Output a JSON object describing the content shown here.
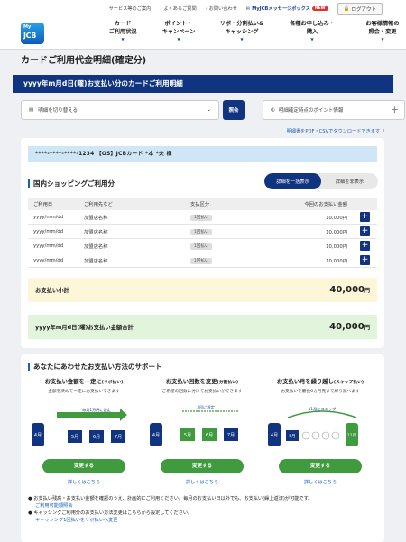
{
  "topbar": {
    "links": [
      "サービス等のご案内",
      "よくあるご質問",
      "お問い合わせ"
    ],
    "message_box": "MyJCBメッセージボックス",
    "new_badge": "NEW",
    "logout": "ログアウト"
  },
  "logo": {
    "my": "My",
    "jcb": "JCB"
  },
  "nav": [
    {
      "line1": "カード",
      "line2": "ご利用状況"
    },
    {
      "line1": "ポイント・",
      "line2": "キャンペーン"
    },
    {
      "line1": "リボ・分割払い&",
      "line2": "キャッシング"
    },
    {
      "line1": "各種お申し込み・",
      "line2": "購入"
    },
    {
      "line1": "お客様情報の",
      "line2": "照会・変更"
    }
  ],
  "page_title": "カードご利用代金明細(確定分)",
  "statement_bar": "yyyy年m月d日(曜)お支払い分のカードご利用明細",
  "controls": {
    "switch_label": "明細を切り替える",
    "apply_label": "照会",
    "point_label": "明細確定時点のポイント情報"
  },
  "download_link": "明細書をPDF・CSVでダウンロードできます",
  "card_band": "****-****-****-1234 【OS】JCBカード *本 *夫 様",
  "domestic": {
    "title": "国内ショッピングご利用分",
    "toggle_show": "詳細を一括表示",
    "toggle_hide": "詳細を非表示",
    "headers": [
      "ご利用日",
      "ご利用先など",
      "支払区分",
      "今回のお支払い金額"
    ],
    "rows": [
      {
        "date": "yyyy/mm/dd",
        "shop": "加盟店名称",
        "type": "1回払い",
        "amount": "10,000円"
      },
      {
        "date": "yyyy/mm/dd",
        "shop": "加盟店名称",
        "type": "1回払い",
        "amount": "10,000円"
      },
      {
        "date": "yyyy/mm/dd",
        "shop": "加盟店名称",
        "type": "1回払い",
        "amount": "10,000円"
      },
      {
        "date": "yyyy/mm/dd",
        "shop": "加盟店名称",
        "type": "1回払い",
        "amount": "10,000円"
      }
    ],
    "subtotal_label": "お支払い小計",
    "subtotal_amount": "40,000",
    "yen": "円"
  },
  "grand_total": {
    "label": "yyyy年m月d日(曜)お支払い金額合計",
    "amount": "40,000",
    "yen": "円"
  },
  "support": {
    "title": "あなたにあわせたお支払い方法のサポート",
    "options": [
      {
        "heading": "お支払い金額を一定に",
        "tag": "(リボ払い)",
        "desc": "金額を決めて一定にお支払いできます",
        "button": "変更する",
        "more": "詳しくはこちら",
        "arrow_label": "毎月1万円に設定",
        "months": [
          "4月",
          "5月",
          "6月",
          "7月"
        ]
      },
      {
        "heading": "お支払い回数を変更",
        "tag": "(分割払い)",
        "desc": "ご希望の回数に分けてお支払いができます",
        "button": "変更する",
        "more": "詳しくはこちら",
        "arrow_label": "3回に設定",
        "months": [
          "4月",
          "5月",
          "6月",
          "7月"
        ]
      },
      {
        "heading": "お支払い月を繰り越し",
        "tag": "(スキップ払い)",
        "desc": "お支払いを最長6カ月先まで繰り延べます",
        "button": "変更する",
        "more": "詳しくはこちら",
        "arrow_label": "11月にスキップ",
        "months": [
          "4月",
          "5月",
          "11月"
        ]
      }
    ],
    "notes": [
      "お支払い残高・お支払い金額を確認のうえ、計画的にご利用ください。毎月のお支払い日以外でも、お支払い(繰上返済)が可能です。",
      "ご利用可能額照会",
      "キャッシングご利用分のお支払い方法変更はこちらから設定してください。",
      "キャッシング1回払いをリボ払いへ変更"
    ]
  }
}
